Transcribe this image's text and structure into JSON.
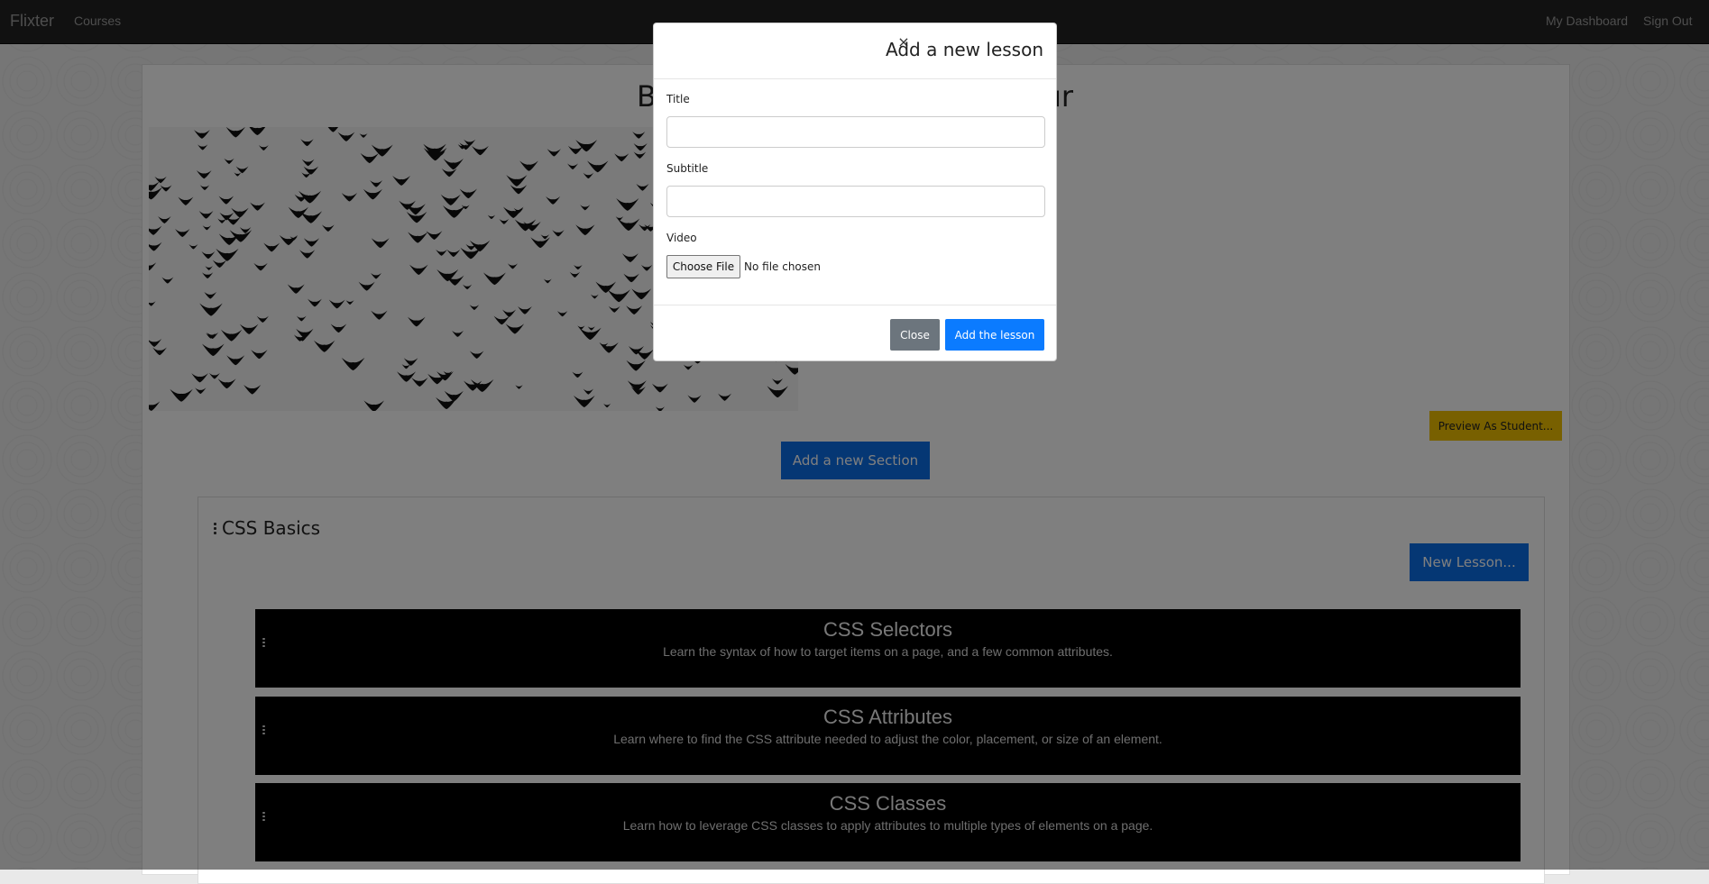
{
  "navbar": {
    "brand": "Flixter",
    "courses_link": "Courses",
    "dashboard_link": "My Dashboard",
    "signout_link": "Sign Out"
  },
  "course": {
    "title_start": "B",
    "title_end": "ur",
    "image_icon": "flock-of-birds-image",
    "preview_button": "Preview As Student...",
    "add_section_button": "Add a new Section"
  },
  "section": {
    "title": "CSS Basics",
    "new_lesson_button": "New Lesson...",
    "lessons": [
      {
        "title": "CSS Selectors",
        "subtitle": "Learn the syntax of how to target items on a page, and a few common attributes."
      },
      {
        "title": "CSS Attributes",
        "subtitle": "Learn where to find the CSS attribute needed to adjust the color, placement, or size of an element."
      },
      {
        "title": "CSS Classes",
        "subtitle": "Learn how to leverage CSS classes to apply attributes to multiple types of elements on a page."
      }
    ]
  },
  "modal": {
    "close_x": "×",
    "title": "Add a new lesson",
    "title_label": "Title",
    "title_value": "",
    "subtitle_label": "Subtitle",
    "subtitle_value": "",
    "video_label": "Video",
    "choose_file_button": "Choose File",
    "file_status": "No file chosen",
    "close_button": "Close",
    "add_button": "Add the lesson"
  },
  "colors": {
    "navbar_bg": "#222222",
    "primary": "#0b6ee8",
    "preview_yellow": "#f0c000",
    "secondary": "#6c757d"
  }
}
